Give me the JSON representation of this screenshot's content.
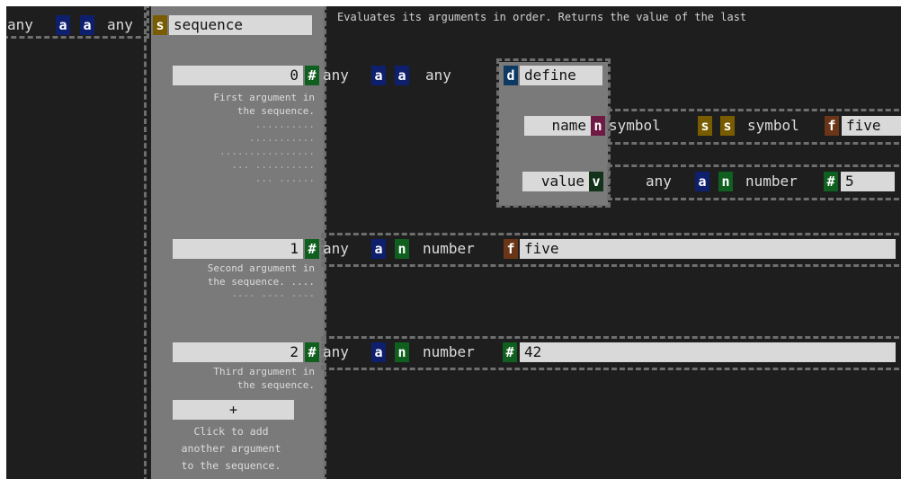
{
  "top": {
    "left_type": "any",
    "left_badge_a1": "a",
    "left_badge_a2": "a",
    "left_type2": "any",
    "seq_badge": "s",
    "seq_title": "sequence",
    "description": "Evaluates its arguments in order. Returns the value of the last"
  },
  "arg0": {
    "index": "0",
    "badge": "#",
    "note_1": "First argument in",
    "note_2": "the sequence.",
    "dots_1": "..........",
    "dots_2": "...........",
    "dots_3": "................",
    "dots_4": "... ..........",
    "dots_5": "... ......",
    "type_any": "any",
    "badge_a1": "a",
    "badge_a2": "a",
    "type_any2": "any",
    "define_badge": "d",
    "define_label": "define",
    "name_label": "name",
    "name_badge": "n",
    "name_type": "symbol",
    "name_badge_s1": "s",
    "name_badge_s2": "s",
    "name_type2": "symbol",
    "name_value_badge": "f",
    "name_value": "five",
    "value_label": "value",
    "value_badge": "v",
    "value_type_any": "any",
    "value_badge_a": "a",
    "value_badge_n": "n",
    "value_type_number": "number",
    "value_hash": "#",
    "value_number": "5"
  },
  "arg1": {
    "index": "1",
    "badge": "#",
    "note_1": "Second argument in",
    "note_2": "the sequence. ....",
    "dots_1": "---- ---- ----",
    "type_any": "any",
    "badge_a": "a",
    "badge_n": "n",
    "type_number": "number",
    "value_badge": "f",
    "value": "five"
  },
  "arg2": {
    "index": "2",
    "badge": "#",
    "note_1": "Third argument in",
    "note_2": "the sequence.",
    "type_any": "any",
    "badge_a": "a",
    "badge_n": "n",
    "type_number": "number",
    "value_badge": "#",
    "value": "42"
  },
  "add": {
    "button_label": "+",
    "note_1": "Click to add",
    "note_2": "another argument",
    "note_3": "to the sequence."
  }
}
